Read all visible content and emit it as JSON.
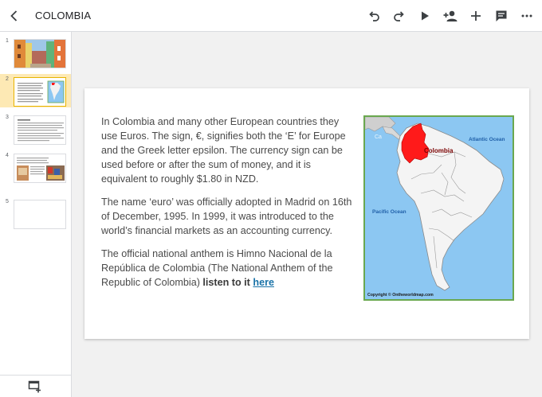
{
  "header": {
    "title": "COLOMBIA",
    "tools": [
      "undo-icon",
      "redo-icon",
      "play-icon",
      "share-person-icon",
      "add-icon",
      "comment-icon",
      "more-icon"
    ]
  },
  "sidebar": {
    "slides": [
      {
        "number": "1"
      },
      {
        "number": "2"
      },
      {
        "number": "3"
      },
      {
        "number": "4"
      },
      {
        "number": "5"
      }
    ],
    "selected": "2"
  },
  "slide": {
    "para1": "In Colombia and many other European countries they use Euros. The sign, €, signifies both the ‘E’ for Europe and the Greek letter epsilon. The currency sign can be used before or after the sum of money, and it is equivalent to roughly $1.80 in NZD.",
    "para2": "The name ‘euro’ was officially adopted in Madrid on 16th of December, 1995. In 1999, it was introduced to the world’s financial markets as an accounting currency.",
    "para3": "The official national anthem is Himno Nacional de la República de Colombia (The National Anthem of the Republic of Colombia)",
    "listen_text": "listen to it",
    "link_text": "here",
    "map": {
      "country_label": "Colombia",
      "atlantic_label": "Atlantic Ocean",
      "pacific_label": "Pacific Ocean",
      "faint_label": "Ca",
      "copyright": "Copyright © Ontheworldmap.com",
      "highlight_color": "#ff1a1a",
      "ocean_color": "#8cc7f2",
      "border_color": "#6aa84f"
    }
  }
}
